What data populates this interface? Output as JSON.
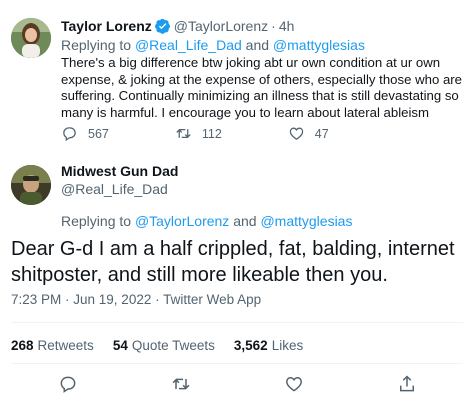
{
  "tweet1": {
    "name": "Taylor Lorenz",
    "handle": "@TaylorLorenz",
    "time": "4h",
    "reply_prefix": "Replying to",
    "reply_handle_1": "@Real_Life_Dad",
    "reply_and": "and",
    "reply_handle_2": "@mattyglesias",
    "text": "There's a big difference btw joking abt ur own condition at ur own expense, & joking at the expense of others, especially those who are suffering. Continually minimizing an illness that is still devastating so many is harmful. I encourage you to learn about lateral ableism",
    "replies": "567",
    "retweets": "112",
    "likes": "47"
  },
  "tweet2": {
    "name": "Midwest Gun Dad",
    "handle": "@Real_Life_Dad",
    "reply_prefix": "Replying to",
    "reply_handle_1": "@TaylorLorenz",
    "reply_and": "and",
    "reply_handle_2": "@mattyglesias",
    "text": "Dear G-d I am a half crippled, fat, balding, internet shitposter, and still more likeable then you.",
    "meta": "7:23 PM · Jun 19, 2022 · Twitter Web App",
    "retweets_count": "268",
    "retweets_label": "Retweets",
    "quote_count": "54",
    "quote_label": "Quote Tweets",
    "likes_count": "3,562",
    "likes_label": "Likes"
  },
  "icons": {
    "verified": "verified-badge-icon",
    "reply": "reply-icon",
    "retweet": "retweet-icon",
    "like": "heart-icon",
    "share": "share-icon"
  },
  "colors": {
    "accent": "#1d9bf0",
    "secondary_text": "#536471",
    "primary_text": "#0f1419"
  }
}
